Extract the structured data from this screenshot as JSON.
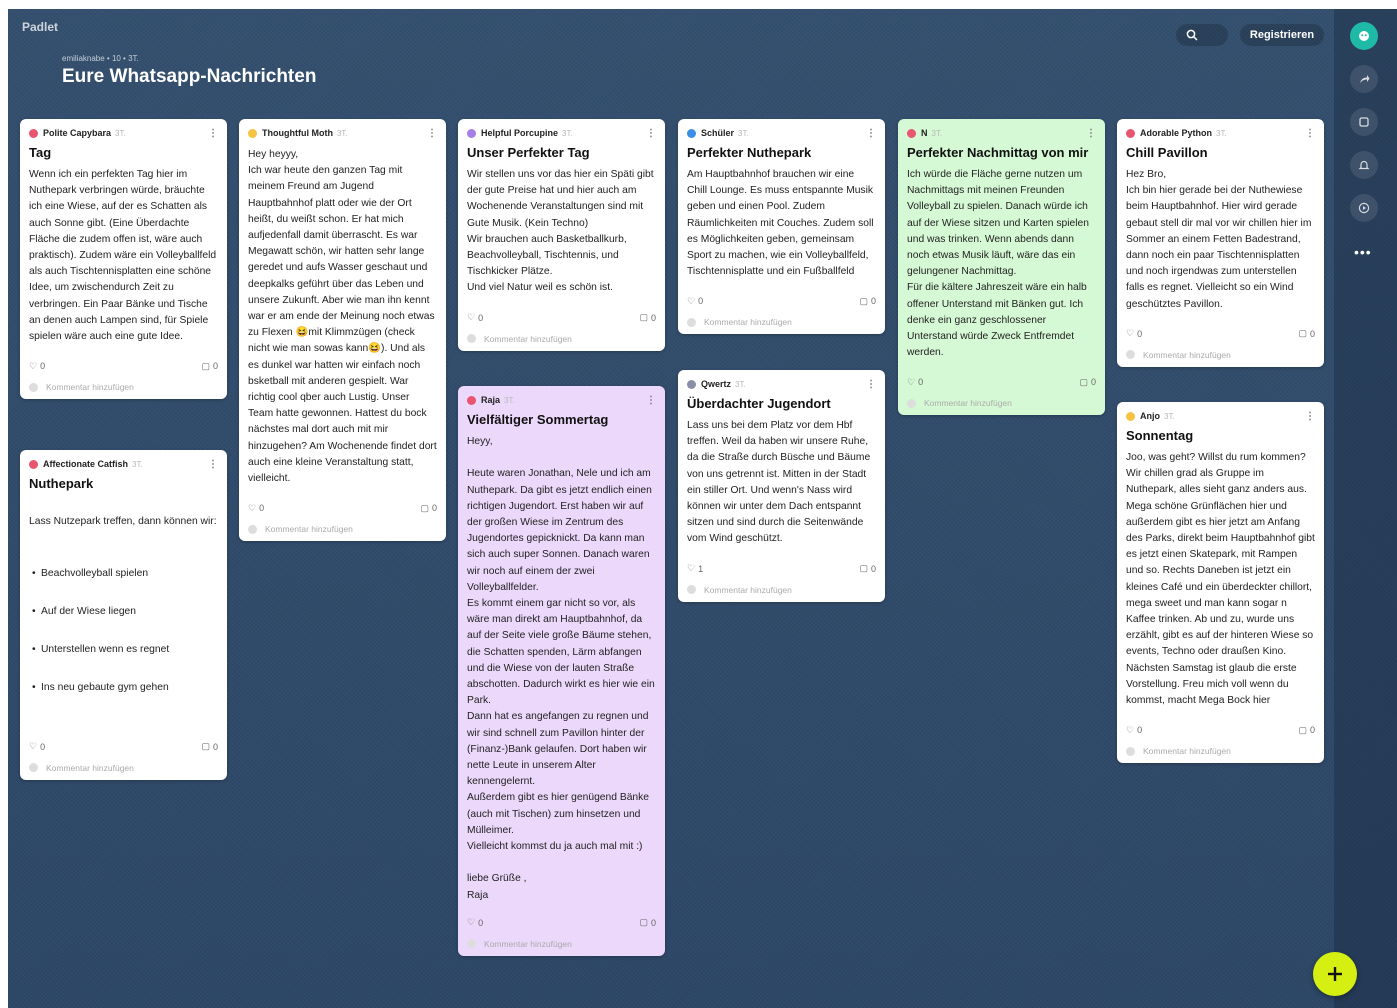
{
  "header": {
    "brand": "Padlet",
    "meta": "emiliaknabe • 10 • 3T.",
    "title": "Eure Whatsapp-Nachrichten",
    "register_label": "Registrieren"
  },
  "comment_placeholder": "Kommentar hinzufügen",
  "cards": [
    {
      "author": "Polite Capybara",
      "time": "3T.",
      "color": "#e8556f",
      "title": "Tag",
      "body": "Wenn ich ein perfekten Tag hier im Nuthepark verbringen würde, bräuchte ich eine Wiese, auf der es Schatten als auch Sonne gibt. (Eine Überdachte Fläche die zudem offen ist, wäre auch praktisch). Zudem wäre ein Volleyballfeld als auch Tischtennisplatten eine schöne Idee, um zwischendurch Zeit zu verbringen. Ein Paar Bänke und Tische an denen auch Lampen sind, für Spiele spielen wäre auch eine gute Idee.",
      "likes": "0",
      "comments": "0"
    },
    {
      "author": "Affectionate Catfish",
      "time": "3T.",
      "color": "#e8556f",
      "title": "Nuthepark",
      "body": "Lass Nutzepark treffen, dann können wir:",
      "bullets": [
        "Beachvolleyball spielen",
        "Auf der Wiese liegen",
        "Unterstellen wenn es regnet",
        "Ins neu gebaute gym gehen"
      ],
      "likes": "0",
      "comments": "0"
    },
    {
      "author": "Thoughtful Moth",
      "time": "3T.",
      "color": "#f5c242",
      "title": "",
      "body": "Hey heyyy,\nIch war heute den ganzen Tag mit meinem Freund am Jugend Hauptbahnhof platt oder wie der Ort heißt, du weißt schon. Er hat mich aufjedenfall damit überrascht. Es war Megawatt schön, wir hatten sehr lange geredet und aufs Wasser geschaut und deepkalks geführt über das Leben und unsere Zukunft. Aber wie man ihn kennt war er am ende der Meinung noch etwas zu Flexen 😆mit Klimmzügen (check nicht wie man sowas kann😆). Und als es dunkel war hatten wir einfach noch bsketball mit anderen gespielt. War richtig cool qber auch Lustig. Unser Team hatte gewonnen. Hattest du bock nächstes mal dort auch mit mir hinzugehen? Am Wochenende findet dort auch eine kleine Veranstaltung statt, vielleicht.",
      "likes": "0",
      "comments": "0"
    },
    {
      "author": "Helpful Porcupine",
      "time": "3T.",
      "color": "#a77de8",
      "title": "Unser Perfekter Tag",
      "body": "Wir stellen uns vor das hier ein Späti gibt der gute Preise hat und hier auch am Wochenende Veranstaltungen sind mit Gute Musik. (Kein Techno)\nWir brauchen auch Basketballkurb, Beachvolleyball, Tischtennis, und Tischkicker Plätze.\nUnd viel Natur weil es schön ist.",
      "likes": "0",
      "comments": "0"
    },
    {
      "author": "Raja",
      "time": "3T.",
      "color": "#e8556f",
      "title": "Vielfältiger Sommertag",
      "body": "Heyy,\n\nHeute waren Jonathan, Nele und ich am Nuthepark. Da gibt es jetzt endlich einen richtigen Jugendort. Erst haben wir auf der großen Wiese im Zentrum des Jugendortes gepicknickt. Da kann man sich auch super Sonnen. Danach waren wir noch auf einem der zwei Volleyballfelder.\nEs kommt einem gar nicht so vor, als wäre man direkt am Hauptbahnhof, da auf der Seite viele große Bäume stehen, die Schatten spenden, Lärm abfangen und die Wiese von der lauten Straße abschotten. Dadurch wirkt es hier wie ein Park.\nDann hat es angefangen zu regnen und wir sind schnell zum Pavillon hinter der\n(Finanz-)Bank gelaufen. Dort haben wir nette Leute in unserem Alter kennengelernt.\nAußerdem gibt es hier genügend Bänke (auch mit Tischen) zum hinsetzen und Mülleimer.\nVielleicht kommst du ja auch mal mit :)\n\nliebe Grüße ,\nRaja",
      "likes": "0",
      "comments": "0"
    },
    {
      "author": "Schüler",
      "time": "3T.",
      "color": "#3a8ee6",
      "title": "Perfekter Nuthepark",
      "body": "Am Hauptbahnhof brauchen wir eine Chill Lounge. Es muss entspannte Musik geben und einen Pool. Zudem Räumlichkeiten mit Couches. Zudem soll es Möglichkeiten geben, gemeinsam Sport zu machen, wie ein Volleyballfeld, Tischtennisplatte und ein Fußballfeld",
      "likes": "0",
      "comments": "0"
    },
    {
      "author": "Qwertz",
      "time": "3T.",
      "color": "#8a8fa8",
      "title": "Überdachter Jugendort",
      "body": "Lass uns bei dem Platz vor dem Hbf treffen. Weil da haben wir unsere Ruhe, da die Straße durch Büsche und Bäume von uns getrennt ist. Mitten in der Stadt ein stiller Ort. Und wenn's Nass wird können wir unter dem Dach entspannt sitzen und sind durch die Seitenwände vom Wind geschützt.",
      "likes": "1",
      "comments": "0"
    },
    {
      "author": "N",
      "time": "3T.",
      "color": "#e8556f",
      "title": "Perfekter Nachmittag von mir",
      "body": "Ich würde die Fläche gerne nutzen um Nachmittags mit meinen Freunden Volleyball zu spielen. Danach würde ich auf der Wiese sitzen und Karten spielen und was trinken. Wenn abends dann noch etwas Musik läuft, wäre das ein gelungener Nachmittag.\nFür die kältere Jahreszeit wäre ein halb offener Unterstand mit Bänken gut. Ich denke ein ganz geschlossener Unterstand würde Zweck Entfremdet werden.",
      "likes": "0",
      "comments": "0"
    },
    {
      "author": "Adorable Python",
      "time": "3T.",
      "color": "#e8556f",
      "title": "Chill Pavillon",
      "body": "Hez Bro,\nIch bin hier gerade bei der Nuthewiese beim Hauptbahnhof. Hier wird gerade gebaut stell dir mal vor wir chillen hier im Sommer an einem Fetten Badestrand, dann noch ein paar Tischtennisplatten und noch irgendwas zum unterstellen falls es regnet. Vielleicht so ein Wind geschütztes Pavillon.",
      "likes": "0",
      "comments": "0"
    },
    {
      "author": "Anjo",
      "time": "3T.",
      "color": "#f5c242",
      "title": "Sonnentag",
      "body": "Joo, was geht? Willst du rum kommen? Wir chillen grad als Gruppe im Nuthepark, alles sieht ganz anders aus. Mega schöne Grünflächen hier und außerdem gibt es hier jetzt am Anfang des Parks, direkt beim Hauptbahnhof gibt es jetzt einen Skatepark, mit Rampen und so. Rechts Daneben ist jetzt ein kleines Café und ein überdeckter chillort, mega sweet und man kann sogar n Kaffee trinken. Ab und zu, wurde uns erzählt, gibt es auf der hinteren Wiese so events, Techno oder draußen Kino. Nächsten Samstag ist glaub die erste Vorstellung. Freu mich voll wenn du kommst, macht Mega Bock hier",
      "likes": "0",
      "comments": "0"
    }
  ]
}
